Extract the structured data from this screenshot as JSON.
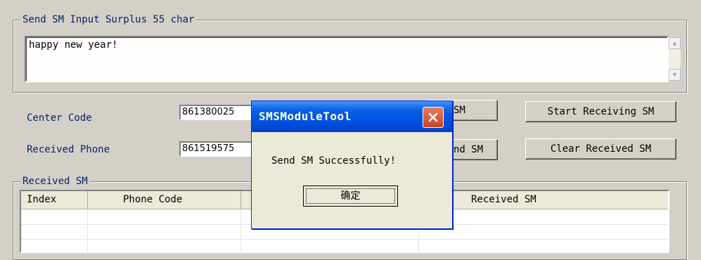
{
  "send_group": {
    "title": "Send SM Input Surplus 55 char",
    "message_text": "happy new year!"
  },
  "form": {
    "center_code_label": "Center Code",
    "center_code_value": "861380025",
    "received_phone_label": "Received Phone",
    "received_phone_value": "861519575"
  },
  "buttons": {
    "send_top_partial": "SM",
    "send_bottom_partial": "nd SM",
    "start_receiving": "Start Receiving SM",
    "clear_received": "Clear Received SM"
  },
  "received_group": {
    "title": "Received SM",
    "columns": [
      "Index",
      "Phone Code",
      "",
      "Received SM"
    ]
  },
  "dialog": {
    "title": "SMSModuleTool",
    "message": "Send SM Successfully!",
    "ok_label": "确定"
  },
  "colors": {
    "window_bg": "#d4d0c8",
    "label_blue": "#0a246a",
    "title_blue": "#0054e3",
    "close_red": "#c74127"
  }
}
